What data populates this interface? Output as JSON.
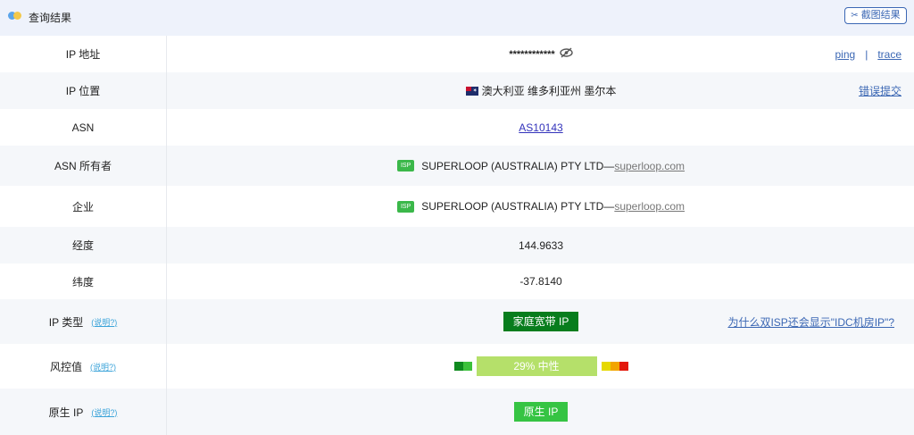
{
  "header": {
    "title": "查询结果",
    "screenshot_label": "截图结果",
    "screenshot_icon": "scissors-icon"
  },
  "rows": {
    "ip": {
      "label": "IP 地址",
      "value": "************",
      "ping": "ping",
      "separator": "|",
      "trace": "trace"
    },
    "location": {
      "label": "IP 位置",
      "value": "澳大利亚 维多利亚州 墨尔本",
      "report": "错误提交"
    },
    "asn": {
      "label": "ASN",
      "value": "AS10143"
    },
    "asn_owner": {
      "label": "ASN 所有者",
      "badge": "ISP",
      "name": "SUPERLOOP (AUSTRALIA) PTY LTD—",
      "domain": "superloop.com"
    },
    "company": {
      "label": "企业",
      "badge": "ISP",
      "name": "SUPERLOOP (AUSTRALIA) PTY LTD—",
      "domain": "superloop.com"
    },
    "longitude": {
      "label": "经度",
      "value": "144.9633"
    },
    "latitude": {
      "label": "纬度",
      "value": "-37.8140"
    },
    "ip_type": {
      "label": "IP 类型",
      "help": "(说明?)",
      "value": "家庭宽带 IP",
      "question": "为什么双ISP还会显示\"IDC机房IP\"?"
    },
    "risk": {
      "label": "风控值",
      "help": "(说明?)",
      "value": "29%  中性",
      "percent": 29
    },
    "native": {
      "label": "原生 IP",
      "help": "(说明?)",
      "value": "原生 IP"
    }
  },
  "colors": {
    "header_bg": "#eef2fb",
    "accent": "#3b67b4",
    "type_badge": "#087d1d",
    "native_badge": "#36c443",
    "risk_bar": "#b5e06a",
    "risk_segments": [
      "#0f8a1f",
      "#3cc13b",
      "#e6d800",
      "#f2a400",
      "#e3170a"
    ]
  }
}
